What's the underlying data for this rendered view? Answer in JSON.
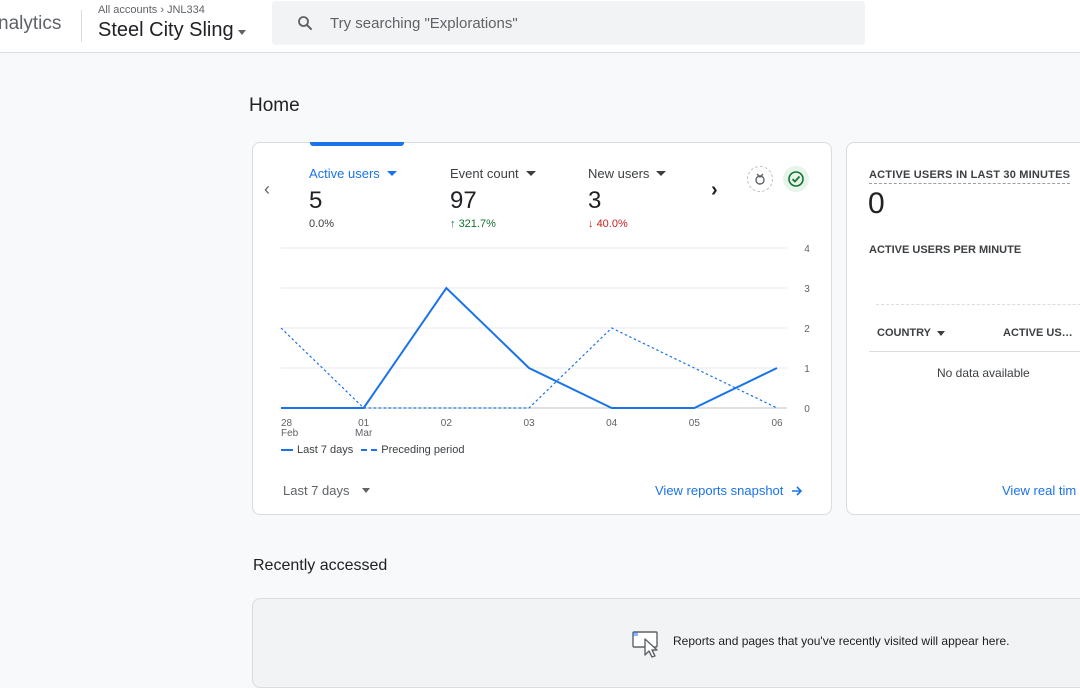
{
  "header": {
    "brand": "nalytics",
    "breadcrumb_root": "All accounts",
    "breadcrumb_account": "JNL334",
    "property_name": "Steel City Sling",
    "search_placeholder": "Try searching \"Explorations\""
  },
  "page_title": "Home",
  "metrics": [
    {
      "label": "Active users",
      "value": "5",
      "delta": "0.0%",
      "trend": "flat",
      "active": true
    },
    {
      "label": "Event count",
      "value": "97",
      "delta": "321.7%",
      "trend": "up",
      "active": false
    },
    {
      "label": "New users",
      "value": "3",
      "delta": "40.0%",
      "trend": "down",
      "active": false
    }
  ],
  "chart_data": {
    "type": "line",
    "categories": [
      "28 Feb",
      "01 Mar",
      "02",
      "03",
      "04",
      "05",
      "06"
    ],
    "x_tick_labels": [
      [
        "28",
        "Feb"
      ],
      [
        "01",
        "Mar"
      ],
      [
        "02"
      ],
      [
        "03"
      ],
      [
        "04"
      ],
      [
        "05"
      ],
      [
        "06"
      ]
    ],
    "series": [
      {
        "name": "Last 7 days",
        "values": [
          0,
          0,
          3,
          1,
          0,
          0,
          1
        ],
        "style": "solid"
      },
      {
        "name": "Preceding period",
        "values": [
          2,
          0,
          0,
          0,
          2,
          1,
          0
        ],
        "style": "dashed"
      }
    ],
    "yticks": [
      0,
      1,
      2,
      3,
      4
    ],
    "ylim": [
      0,
      4
    ],
    "grid": true,
    "legend_placement": "bottom-left",
    "color": "#1a73e8"
  },
  "main_card": {
    "date_range": "Last 7 days",
    "snapshot_link": "View reports snapshot"
  },
  "realtime": {
    "title": "ACTIVE USERS IN LAST 30 MINUTES",
    "value": "0",
    "per_minute_label": "ACTIVE USERS PER MINUTE",
    "col_country": "COUNTRY",
    "col_active": "ACTIVE US…",
    "no_data": "No data available",
    "link": "View real tim"
  },
  "recent": {
    "title": "Recently accessed",
    "message": "Reports and pages that you've recently visited will appear here."
  },
  "colors": {
    "accent": "#1a73e8",
    "positive": "#137333",
    "negative": "#c5221f"
  },
  "icons": [
    "search-icon",
    "chevron-left-icon",
    "chevron-right-icon",
    "insights-icon",
    "check-circle-icon",
    "arrow-right-icon",
    "cursor-window-icon"
  ]
}
